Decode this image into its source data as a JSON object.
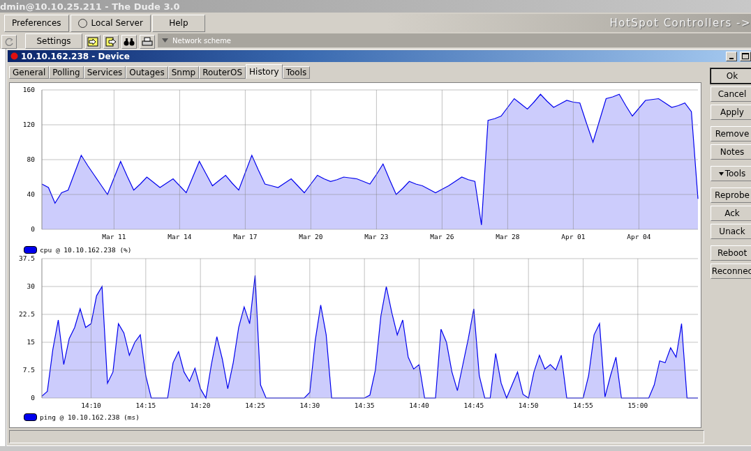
{
  "app_window": {
    "title": "dmin@10.10.25.211 - The Dude 3.0"
  },
  "menu": [
    {
      "label": "Preferences",
      "kind": "button"
    },
    {
      "label": "Local Server",
      "kind": "radio"
    },
    {
      "label": "Help",
      "kind": "button"
    }
  ],
  "banner": "HotSpot Controllers ->",
  "toolbar": {
    "settings": "Settings",
    "network_scheme": "Network scheme"
  },
  "device_window": {
    "title": "10.10.162.238 - Device",
    "tabs": [
      {
        "label": "General",
        "selected": false
      },
      {
        "label": "Polling",
        "selected": false
      },
      {
        "label": "Services",
        "selected": false
      },
      {
        "label": "Outages",
        "selected": false
      },
      {
        "label": "Snmp",
        "selected": false
      },
      {
        "label": "RouterOS",
        "selected": false
      },
      {
        "label": "History",
        "selected": true
      },
      {
        "label": "Tools",
        "selected": false
      }
    ],
    "charts": [
      {
        "chart_data": {
          "type": "area",
          "grid": true,
          "ylim": [
            0,
            160
          ],
          "yticks": [
            0,
            40,
            80,
            120,
            160
          ],
          "categories": [
            null,
            null,
            null,
            null,
            null,
            null,
            null,
            null,
            null,
            null,
            null,
            "Mar 11",
            null,
            null,
            null,
            null,
            null,
            null,
            null,
            null,
            null,
            "Mar 14",
            null,
            null,
            null,
            null,
            null,
            null,
            null,
            null,
            null,
            "Mar 17",
            null,
            null,
            null,
            null,
            null,
            null,
            null,
            null,
            null,
            "Mar 20",
            null,
            null,
            null,
            null,
            null,
            null,
            null,
            null,
            null,
            "Mar 23",
            null,
            null,
            null,
            null,
            null,
            null,
            null,
            null,
            null,
            "Mar 26",
            null,
            null,
            null,
            null,
            null,
            null,
            null,
            null,
            null,
            "Mar 28",
            null,
            null,
            null,
            null,
            null,
            null,
            null,
            null,
            null,
            "Apr 01",
            null,
            null,
            null,
            null,
            null,
            null,
            null,
            null,
            null,
            "Apr 04",
            null,
            null,
            null,
            null,
            null,
            null,
            null,
            null,
            null
          ],
          "series": [
            {
              "name": "cpu @ 10.10.162.238 (%)",
              "color": "#0000ee",
              "values": [
                52,
                48,
                30,
                42,
                45,
                65,
                85,
                73,
                62,
                51,
                40,
                59,
                78,
                61,
                45,
                52,
                60,
                54,
                48,
                53,
                58,
                50,
                42,
                60,
                78,
                64,
                50,
                56,
                62,
                53,
                45,
                65,
                85,
                68,
                52,
                50,
                48,
                53,
                58,
                50,
                42,
                52,
                62,
                58,
                55,
                57,
                60,
                59,
                58,
                55,
                52,
                63,
                75,
                57,
                40,
                47,
                55,
                52,
                50,
                46,
                42,
                46,
                50,
                55,
                60,
                57,
                55,
                5,
                125,
                127,
                130,
                140,
                150,
                144,
                138,
                146,
                155,
                147,
                140,
                144,
                148,
                146,
                145,
                122,
                100,
                125,
                150,
                152,
                155,
                142,
                130,
                139,
                148,
                149,
                150,
                145,
                140,
                142,
                145,
                135,
                35
              ]
            }
          ]
        }
      },
      {
        "chart_data": {
          "type": "area",
          "grid": true,
          "ylim": [
            0,
            37.5
          ],
          "yticks": [
            0,
            7.5,
            15,
            22.5,
            30,
            37.5
          ],
          "categories": [
            null,
            null,
            null,
            null,
            null,
            null,
            null,
            null,
            null,
            "14:10",
            null,
            null,
            null,
            null,
            null,
            null,
            null,
            null,
            null,
            "14:15",
            null,
            null,
            null,
            null,
            null,
            null,
            null,
            null,
            null,
            "14:20",
            null,
            null,
            null,
            null,
            null,
            null,
            null,
            null,
            null,
            "14:25",
            null,
            null,
            null,
            null,
            null,
            null,
            null,
            null,
            null,
            "14:30",
            null,
            null,
            null,
            null,
            null,
            null,
            null,
            null,
            null,
            "14:35",
            null,
            null,
            null,
            null,
            null,
            null,
            null,
            null,
            null,
            "14:40",
            null,
            null,
            null,
            null,
            null,
            null,
            null,
            null,
            null,
            "14:45",
            null,
            null,
            null,
            null,
            null,
            null,
            null,
            null,
            null,
            "14:50",
            null,
            null,
            null,
            null,
            null,
            null,
            null,
            null,
            null,
            "14:55",
            null,
            null,
            null,
            null,
            null,
            null,
            null,
            null,
            null,
            "15:00",
            null,
            null,
            null,
            null,
            null,
            null,
            null,
            null,
            null,
            null,
            null
          ],
          "series": [
            {
              "name": "ping @ 10.10.162.238 (ms)",
              "color": "#0000ee",
              "values": [
                0.5,
                1.8,
                13,
                21,
                9,
                16,
                19,
                24,
                19,
                20,
                27.5,
                30,
                4,
                7,
                20,
                17.5,
                11.5,
                15,
                17,
                6,
                0,
                0,
                0,
                0,
                9.5,
                12.5,
                7,
                4.5,
                8,
                2.5,
                0,
                9,
                16.5,
                10.5,
                2.5,
                9.5,
                19,
                24.5,
                20,
                33,
                3.5,
                0,
                0,
                0,
                0,
                0,
                0,
                0,
                0,
                1.5,
                15.5,
                25,
                17,
                0,
                0,
                0,
                0,
                0,
                0,
                0,
                0.8,
                7.5,
                22,
                30,
                23,
                17,
                21,
                11,
                7.8,
                9,
                0,
                0,
                0,
                18.5,
                15,
                7,
                2,
                9,
                16,
                24,
                6,
                0,
                0,
                12,
                4,
                0,
                3.5,
                7,
                1,
                0,
                7,
                11.5,
                7.8,
                9,
                7.5,
                11.5,
                0,
                0,
                0,
                0,
                6,
                17,
                20,
                0.3,
                6,
                11,
                0,
                0,
                0,
                0,
                0,
                0,
                3.5,
                10,
                9.5,
                13.5,
                11,
                20,
                0,
                0,
                0
              ]
            }
          ]
        }
      }
    ],
    "button_groups": [
      {
        "buttons": [
          {
            "label": "Ok",
            "kind": "plain",
            "default": true
          },
          {
            "label": "Cancel",
            "kind": "plain",
            "default": false
          },
          {
            "label": "Apply",
            "kind": "plain",
            "default": false
          }
        ]
      },
      {
        "buttons": [
          {
            "label": "Remove",
            "kind": "plain",
            "default": false
          },
          {
            "label": "Notes",
            "kind": "plain",
            "default": false
          }
        ]
      },
      {
        "buttons": [
          {
            "label": "Tools",
            "kind": "menu",
            "default": false
          }
        ]
      },
      {
        "buttons": [
          {
            "label": "Reprobe",
            "kind": "plain",
            "default": false
          },
          {
            "label": "Ack",
            "kind": "plain",
            "default": false
          },
          {
            "label": "Unack",
            "kind": "plain",
            "default": false
          }
        ]
      },
      {
        "buttons": [
          {
            "label": "Reboot",
            "kind": "plain",
            "default": false
          },
          {
            "label": "Reconnec",
            "kind": "plain",
            "default": false
          }
        ]
      }
    ]
  }
}
